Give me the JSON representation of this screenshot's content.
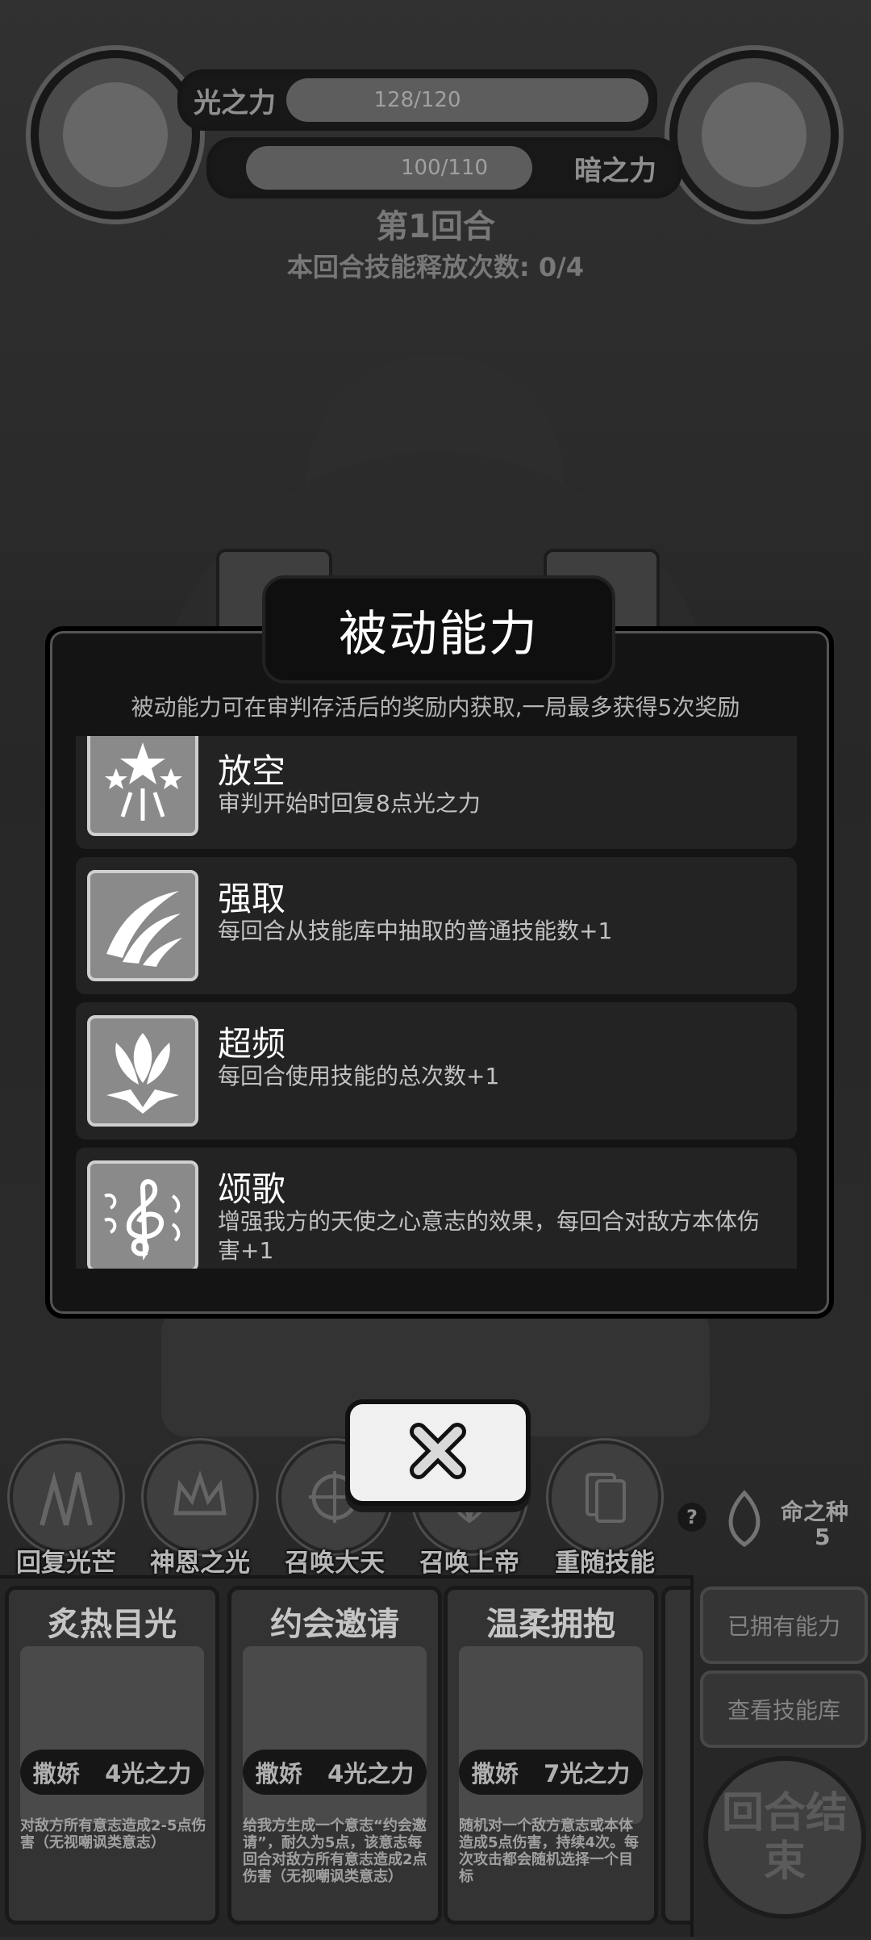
{
  "hud": {
    "light_label": "光之力",
    "light_value": "128/120",
    "light_fill": 1.0,
    "dark_label": "暗之力",
    "dark_value": "100/110",
    "dark_fill": 0.91,
    "round_title": "第1回合",
    "round_sub": "本回合技能释放次数: 0/4"
  },
  "skills_bar": [
    {
      "label": "回复光芒",
      "icon": "light-spikes-icon"
    },
    {
      "label": "神恩之光",
      "icon": "crown-icon"
    },
    {
      "label": "召唤大天使",
      "icon": "compass-icon"
    },
    {
      "label": "召唤上帝",
      "icon": "wing-icon"
    },
    {
      "label": "重随技能",
      "icon": "cards-icon"
    }
  ],
  "seed": {
    "label": "命之种",
    "count": "5",
    "help": "?"
  },
  "cards": [
    {
      "title": "炙热目光",
      "tag": "撒娇",
      "cost": "4光之力",
      "desc": "对敌方所有意志造成2-5点伤害（无视嘲讽类意志）"
    },
    {
      "title": "约会邀请",
      "tag": "撒娇",
      "cost": "4光之力",
      "desc": "给我方生成一个意志“约会邀请”，耐久为5点，该意志每回合对敌方所有意志造成2点伤害（无视嘲讽类意志）"
    },
    {
      "title": "温柔拥抱",
      "tag": "撒娇",
      "cost": "7光之力",
      "desc": "随机对一个敌方意志或本体造成5点伤害，持续4次。每次攻击都会随机选择一个目标"
    }
  ],
  "side_buttons": {
    "owned": "已拥有能力",
    "library": "查看技能库",
    "end_round": "回合结束"
  },
  "modal": {
    "title": "被动能力",
    "subtitle": "被动能力可在审判存活后的奖励内获取,一局最多获得5次奖励",
    "items": [
      {
        "name": "放空",
        "desc": "审判开始时回复8点光之力",
        "icon": "stars-burst-icon"
      },
      {
        "name": "强取",
        "desc": "每回合从技能库中抽取的普通技能数+1",
        "icon": "claw-swipe-icon"
      },
      {
        "name": "超频",
        "desc": "每回合使用技能的总次数+1",
        "icon": "flame-burst-icon"
      },
      {
        "name": "颂歌",
        "desc": "增强我方的天使之心意志的效果，每回合对敌方本体伤害+1",
        "icon": "treble-clef-icon"
      }
    ],
    "close_icon": "close-icon"
  },
  "colors": {
    "modal_bg": "#141414",
    "item_bg": "#232323",
    "icon_bg": "#8a8a8a"
  }
}
